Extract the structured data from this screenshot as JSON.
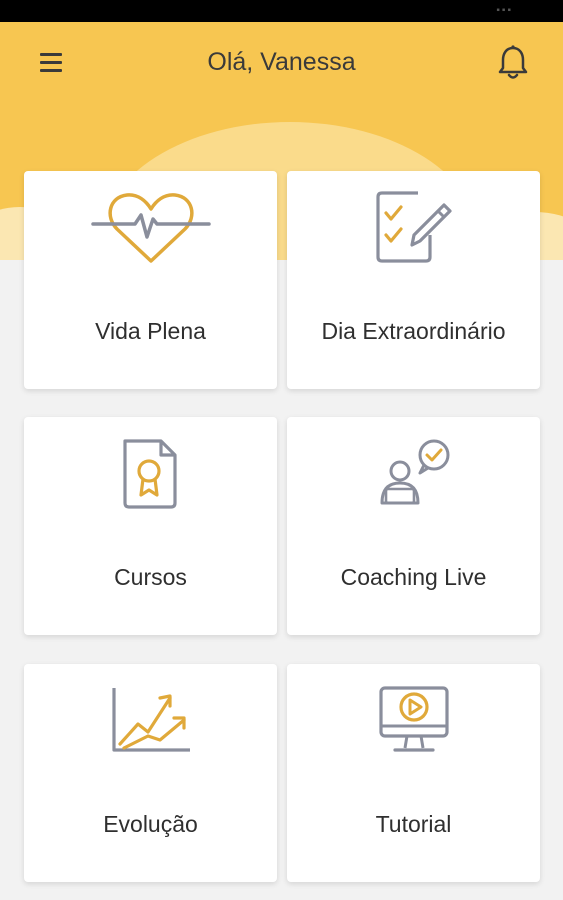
{
  "header": {
    "greeting": "Olá, Vanessa"
  },
  "colors": {
    "accent": "#f7c651",
    "icon_gold": "#e0a93a",
    "icon_gray": "#8a8e9c"
  },
  "cards": [
    {
      "label": "Vida Plena",
      "icon": "heartbeat-icon"
    },
    {
      "label": "Dia Extraordinário",
      "icon": "checklist-icon"
    },
    {
      "label": "Cursos",
      "icon": "certificate-icon"
    },
    {
      "label": "Coaching Live",
      "icon": "coaching-chat-icon"
    },
    {
      "label": "Evolução",
      "icon": "growth-chart-icon"
    },
    {
      "label": "Tutorial",
      "icon": "video-monitor-icon"
    }
  ]
}
